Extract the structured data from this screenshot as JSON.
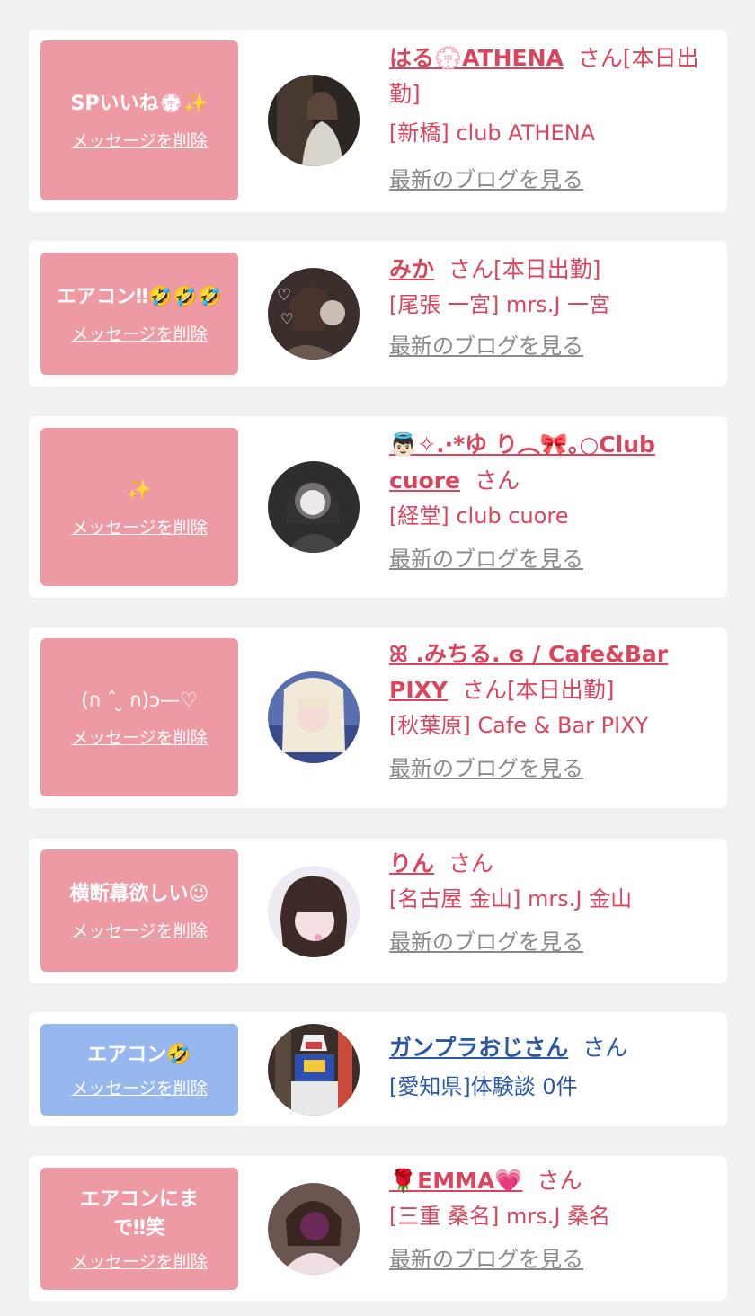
{
  "colors": {
    "pink_bubble": "#ee9aa4",
    "blue_bubble": "#97b8ee",
    "accent_text": "#d9455c",
    "blue_text": "#2a58a5",
    "muted": "#8a8a8a",
    "bg": "#f1f1f1"
  },
  "delete_label": "メッセージを削除",
  "blog_label": "最新のブログを見る",
  "items": [
    {
      "message": "SPいいね💮✨",
      "name": "はる💮ATHENA",
      "suffix": "さん[本日出勤]",
      "shop": "[新橋] club ATHENA",
      "avatar_icon": "avatar-photo"
    },
    {
      "message": "エアコン‼🤣🤣🤣",
      "name": "みか",
      "suffix": "さん[本日出勤]",
      "shop": "[尾張 一宮] mrs.J 一宮",
      "avatar_icon": "avatar-photo"
    },
    {
      "message": "✨",
      "name": "👼🏻✧.·*ゆ り︵🎀｡○Club cuore",
      "suffix": "さん",
      "shop": "[経堂] club cuore",
      "avatar_icon": "avatar-photo"
    },
    {
      "message": "(ก ˆ ̮ ก)ɔ—♡",
      "name": "ꕤ .みちる. ɞ / Cafe&Bar PIXY",
      "suffix": "さん[本日出勤]",
      "shop": "[秋葉原] Cafe & Bar PIXY",
      "avatar_icon": "avatar-photo"
    },
    {
      "message": "横断幕欲しい😉",
      "name": "りん",
      "suffix": "さん",
      "shop": "[名古屋 金山] mrs.J 金山",
      "avatar_icon": "avatar-photo"
    },
    {
      "message": "エアコン🤣",
      "name": "ガンプラおじさん",
      "suffix": "さん",
      "shop": "[愛知県]体験談 0件",
      "avatar_icon": "avatar-photo"
    },
    {
      "message": "エアコンにまで‼笑",
      "name": "🌹EMMA💗",
      "suffix": "さん",
      "shop": "[三重 桑名] mrs.J 桑名",
      "avatar_icon": "avatar-photo"
    }
  ]
}
